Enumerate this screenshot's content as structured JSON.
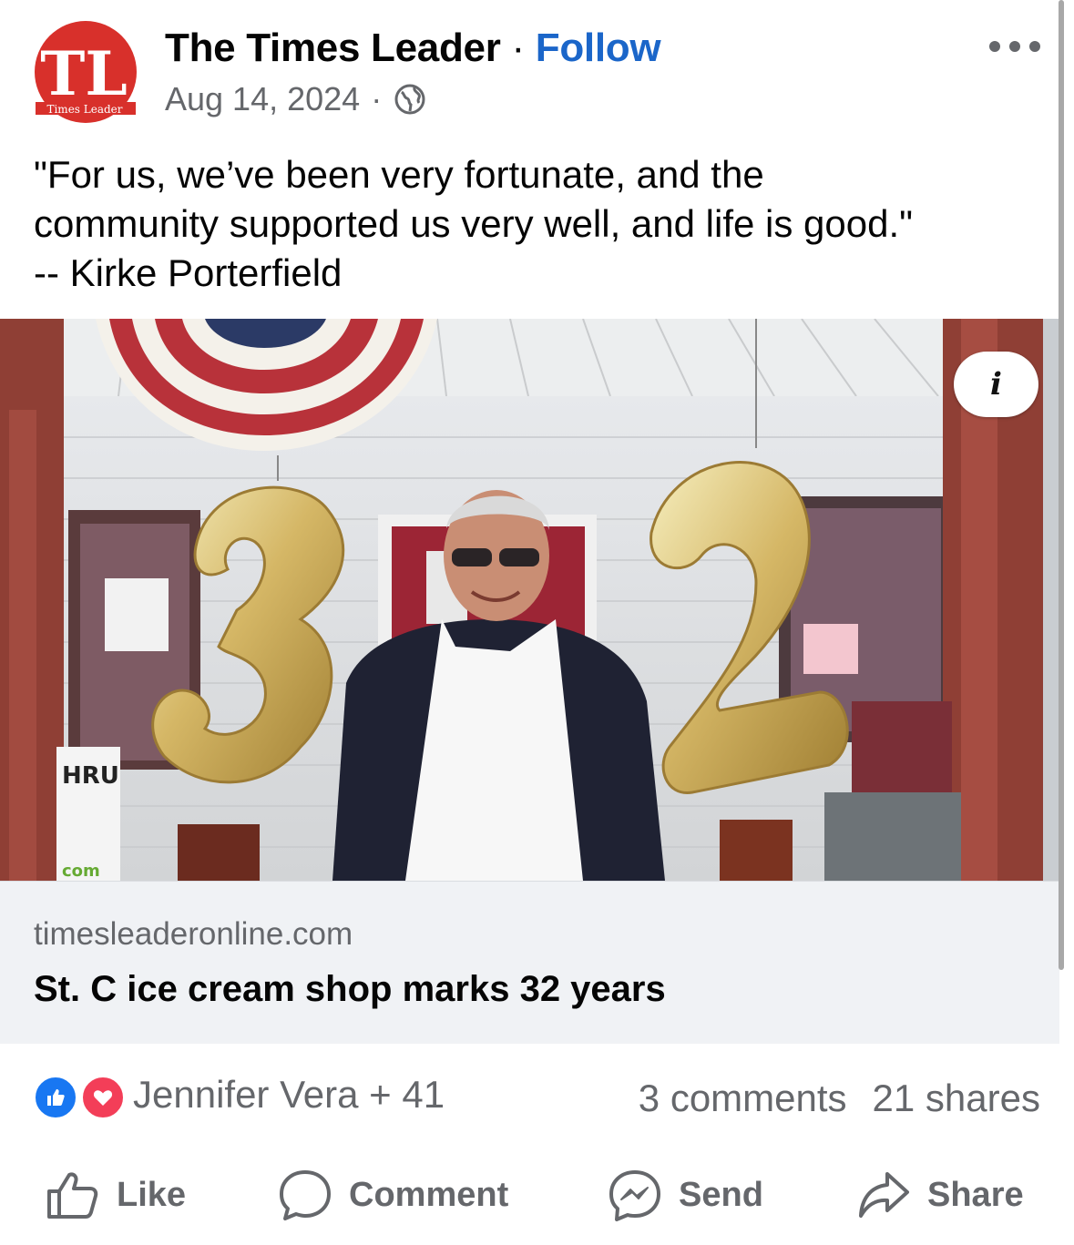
{
  "post": {
    "page_name": "The Times Leader",
    "separator": "·",
    "follow_label": "Follow",
    "date": "Aug 14, 2024",
    "meta_separator": "·",
    "avatar": {
      "initials": "TL",
      "subtitle": "Times Leader",
      "color": "#d8302b"
    },
    "caption_lines": [
      "\"For us, we’ve been very fortunate, and the",
      "community supported us very well, and life is good.\"",
      "-- Kirke Porterfield"
    ]
  },
  "photo": {
    "info_label": "i",
    "sign_text": "HRU",
    "sign_text_2": "com"
  },
  "link_preview": {
    "domain": "timesleaderonline.com",
    "title": "St. C ice cream shop marks 32 years"
  },
  "engagement": {
    "reactors": "Jennifer Vera + 41",
    "comments": "3 comments",
    "shares": "21 shares"
  },
  "actions": {
    "like": "Like",
    "comment": "Comment",
    "send": "Send",
    "share": "Share"
  },
  "colors": {
    "follow": "#1b66c9",
    "like_reaction": "#1877f2",
    "love_reaction": "#f33e58",
    "muted_text": "#65676b"
  }
}
